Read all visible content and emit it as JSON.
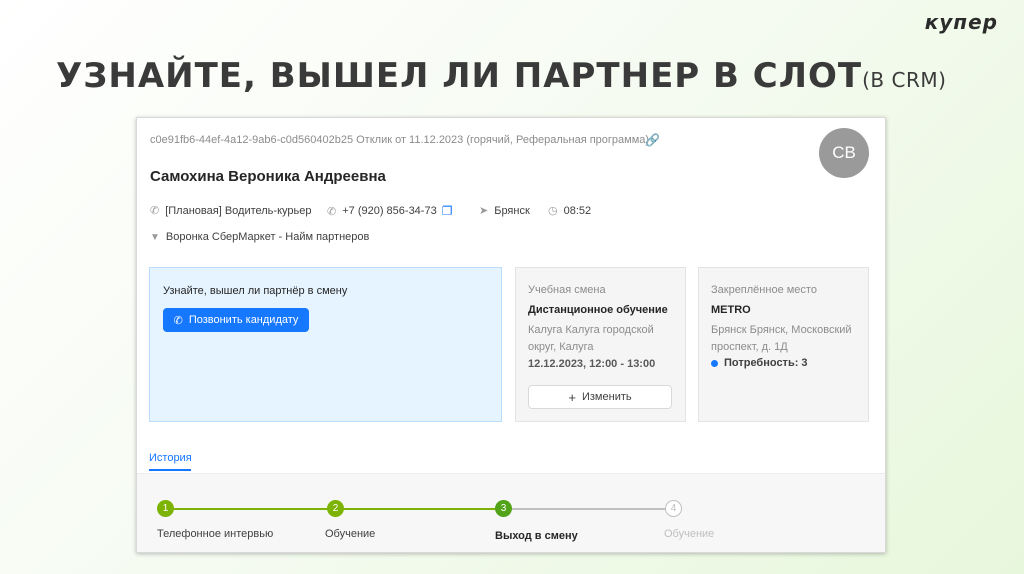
{
  "slide": {
    "logo": "купер",
    "title": "УЗНАЙТЕ, ВЫШЕЛ ЛИ ПАРТНЕР В СЛОТ",
    "title_sub": "(В CRM)"
  },
  "crm": {
    "meta": "c0e91fb6-44ef-4a12-9ab6-c0d560402b25 Отклик от 11.12.2023 (горячий, Реферальная программа)",
    "avatar": "СВ",
    "name": "Самохина Вероника Андреевна",
    "vacancy": "[Плановая] Водитель-курьер",
    "phone": "+7 (920) 856-34-73",
    "city": "Брянск",
    "time": "08:52",
    "funnel": "Воронка СберМаркет - Найм партнеров",
    "task": {
      "title": "Узнайте, вышел ли партнёр в смену",
      "button": "Позвонить кандидату"
    },
    "shift": {
      "label": "Учебная смена",
      "name": "Дистанционное обучение",
      "address_line1": "Калуга Калуга городской",
      "address_line2": "округ, Калуга",
      "datetime": "12.12.2023, 12:00 - 13:00",
      "change_button": "Изменить"
    },
    "place": {
      "label": "Закреплённое место",
      "name": "METRO",
      "address_line1": "Брянск Брянск, Московский",
      "address_line2": "проспект, д. 1Д",
      "need": "Потребность: 3"
    },
    "tab": "История",
    "steps": [
      {
        "num": "1",
        "label": "Телефонное интервью",
        "state": "done"
      },
      {
        "num": "2",
        "label": "Обучение",
        "state": "done"
      },
      {
        "num": "3",
        "label": "Выход в смену",
        "state": "current"
      },
      {
        "num": "4",
        "label": "Обучение",
        "state": "pending"
      }
    ],
    "colors": {
      "primary": "#1677ff",
      "step_done": "#7cb305",
      "step_current": "#52a318",
      "step_pending": "#bfbfbf"
    }
  }
}
